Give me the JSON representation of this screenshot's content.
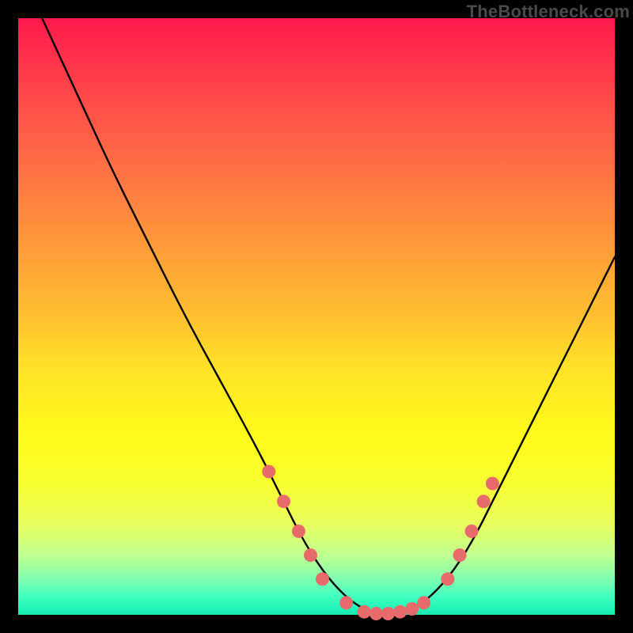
{
  "watermark": "TheBottleneck.com",
  "chart_data": {
    "type": "line",
    "title": "",
    "xlabel": "",
    "ylabel": "",
    "xlim": [
      0,
      100
    ],
    "ylim": [
      0,
      100
    ],
    "grid": false,
    "series": [
      {
        "name": "bottleneck-curve",
        "color": "#000000",
        "x": [
          4,
          10,
          16,
          22,
          28,
          34,
          40,
          44,
          48,
          52,
          56,
          60,
          64,
          68,
          72,
          76,
          80,
          84,
          88,
          92,
          96,
          100
        ],
        "y": [
          100,
          87,
          74,
          62,
          50,
          39,
          28,
          20,
          12,
          6,
          2,
          0,
          0,
          2,
          6,
          12,
          20,
          28,
          36,
          44,
          52,
          60
        ]
      }
    ],
    "markers": {
      "name": "highlight-dots",
      "color": "#e86b6b",
      "points": [
        {
          "x": 42,
          "y": 24
        },
        {
          "x": 44.5,
          "y": 19
        },
        {
          "x": 47,
          "y": 14
        },
        {
          "x": 49,
          "y": 10
        },
        {
          "x": 51,
          "y": 6
        },
        {
          "x": 55,
          "y": 2
        },
        {
          "x": 58,
          "y": 0.5
        },
        {
          "x": 60,
          "y": 0.2
        },
        {
          "x": 62,
          "y": 0.2
        },
        {
          "x": 64,
          "y": 0.5
        },
        {
          "x": 66,
          "y": 1
        },
        {
          "x": 68,
          "y": 2
        },
        {
          "x": 72,
          "y": 6
        },
        {
          "x": 74,
          "y": 10
        },
        {
          "x": 76,
          "y": 14
        },
        {
          "x": 78,
          "y": 19
        },
        {
          "x": 79.5,
          "y": 22
        }
      ]
    },
    "background_gradient": {
      "top": "#ff1a4d",
      "mid": "#fff020",
      "bottom": "#18e8b0"
    }
  }
}
